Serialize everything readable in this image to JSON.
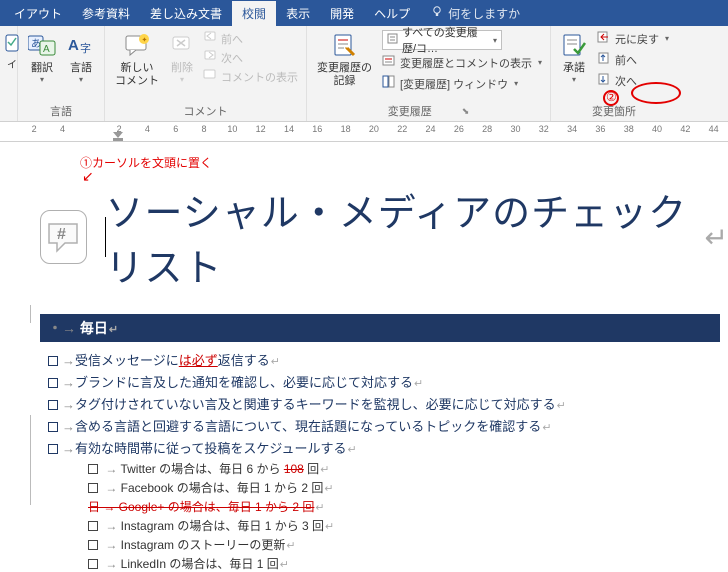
{
  "tabs": {
    "layout": "イアウト",
    "references": "参考資料",
    "mailings": "差し込み文書",
    "review": "校閲",
    "view": "表示",
    "developer": "開発",
    "help": "ヘルプ",
    "tellme": "何をしますか"
  },
  "ribbon": {
    "translate": "翻訳",
    "language": "言語",
    "language_group": "言語",
    "new_comment": "新しい\nコメント",
    "delete": "削除",
    "prev": "前へ",
    "next": "次へ",
    "show_comments": "コメントの表示",
    "comments_group": "コメント",
    "track_record": "変更履歴の\n記録",
    "display_select": "すべての変更履歴/コ…",
    "show_markup": "変更履歴とコメントの表示",
    "review_pane": "[変更履歴] ウィンドウ",
    "tracking_group": "変更履歴",
    "accept": "承諾",
    "undo": "元に戻す",
    "c_prev": "前へ",
    "c_next": "次へ",
    "changes_group": "変更箇所"
  },
  "ruler": [
    "2",
    "4",
    "",
    "2",
    "4",
    "6",
    "8",
    "10",
    "12",
    "14",
    "16",
    "18",
    "20",
    "22",
    "24",
    "26",
    "28",
    "30",
    "32",
    "34",
    "36",
    "38",
    "40",
    "42",
    "44"
  ],
  "annotations": {
    "anno1": "①カーソルを文頭に置く",
    "anno2": "②"
  },
  "document": {
    "title": "ソーシャル・メディアのチェックリスト",
    "section": "毎日",
    "items": [
      {
        "pre": "受信メッセージに",
        "ins": "は必ず",
        "post": "返信する"
      },
      {
        "text": "ブランドに言及した通知を確認し、必要に応じて対応する"
      },
      {
        "text": "タグ付けされていない言及と関連するキーワードを監視し、必要に応じて対応する"
      },
      {
        "text": "含める言語と回避する言語について、現在話題になっているトピックを確認する"
      },
      {
        "text": "有効な時間帯に従って投稿をスケジュールする"
      }
    ],
    "subitems": [
      {
        "pre": "Twitter の場合は、毎日 6 から ",
        "strike": "108",
        "post": " 回"
      },
      {
        "text": "Facebook の場合は、毎日 1 から 2 回"
      },
      {
        "strike_full": "日 → Google+ の場合は、毎日 1 から 2 回"
      },
      {
        "text": "Instagram の場合は、毎日 1 から 3 回"
      },
      {
        "text": "Instagram のストーリーの更新"
      },
      {
        "text": "LinkedIn の場合は、毎日 1 回"
      }
    ]
  }
}
